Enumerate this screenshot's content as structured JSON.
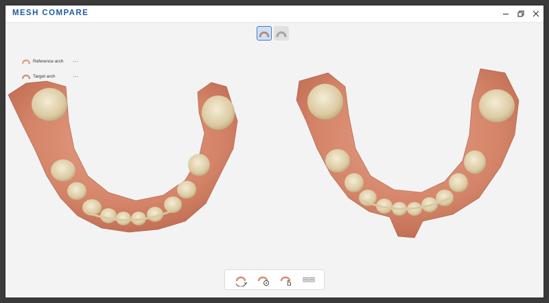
{
  "window": {
    "title": "MESH COMPARE"
  },
  "window_controls": [
    "minimize-icon",
    "restore-icon",
    "close-icon"
  ],
  "view_toggle": [
    {
      "name": "colored-arch-view",
      "icon": "arch-color-icon",
      "active": true
    },
    {
      "name": "gray-arch-view",
      "icon": "arch-gray-icon",
      "active": false
    }
  ],
  "legend": {
    "items": [
      {
        "label": "Reference arch",
        "more": "···"
      },
      {
        "label": "Target arch",
        "more": "···"
      }
    ]
  },
  "bottom_toolbar": {
    "tools": [
      {
        "name": "align-arches-tool",
        "icon": "rotate-arch-icon"
      },
      {
        "name": "point-align-tool",
        "icon": "arch-target-icon"
      },
      {
        "name": "manual-select-tool",
        "icon": "arch-hand-icon"
      },
      {
        "name": "side-by-side-tool",
        "icon": "split-view-icon"
      }
    ]
  },
  "colors": {
    "accent": "#1f5aa6",
    "gum": "#d88a70",
    "tooth": "#e4d7b6",
    "background": "#f3f3f3"
  }
}
